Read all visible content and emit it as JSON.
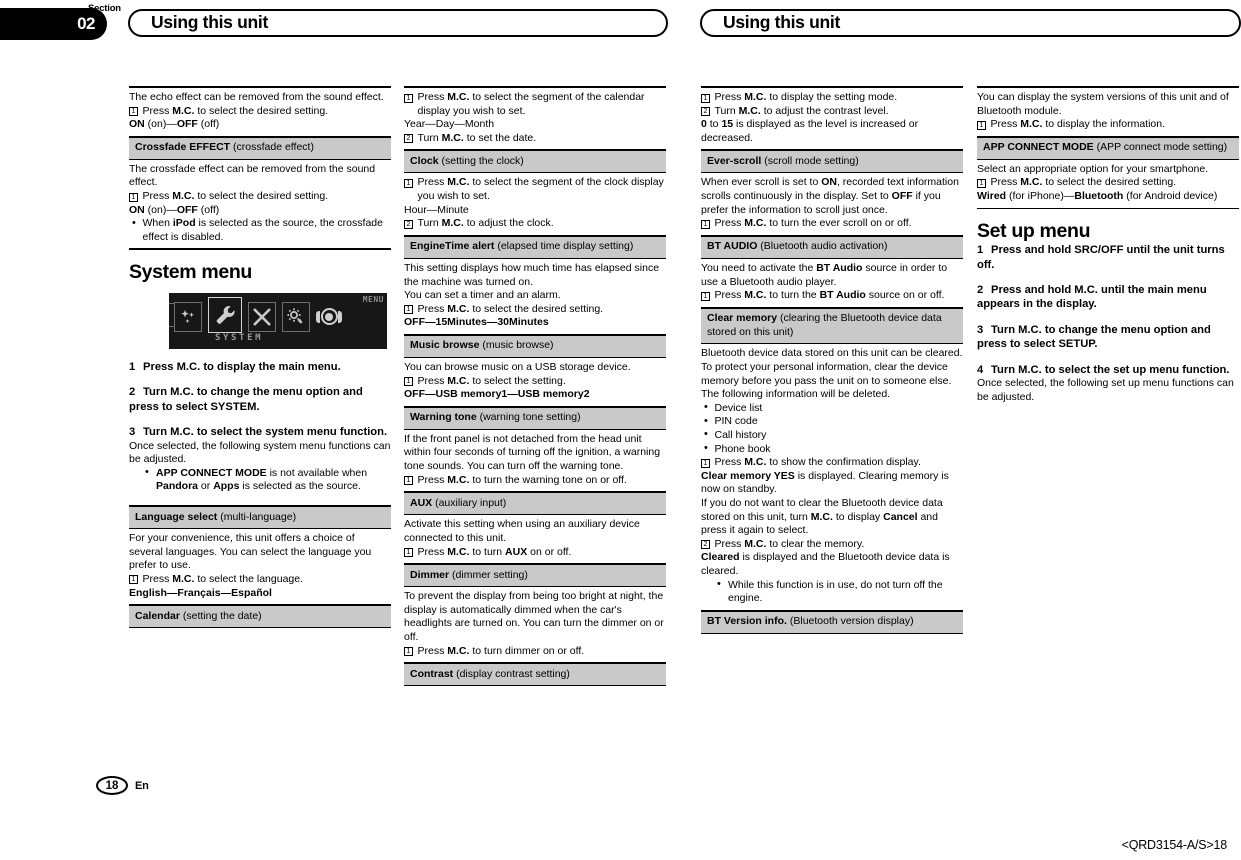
{
  "header": {
    "section_word": "Section",
    "section_number": "02",
    "title_left": "Using this unit",
    "title_right": "Using this unit"
  },
  "footer": {
    "page_number": "18",
    "language_code": "En",
    "doc_code": "<QRD3154-A/S>18"
  },
  "display_graphic": {
    "selected_label": "SYSTEM",
    "menu_label": "MENU"
  },
  "col1": {
    "echo_text": "The echo effect can be removed from the sound effect.",
    "echo_step1": "Press <b>M.C.</b> to select the desired setting.",
    "echo_options": "<b>ON</b> (on)—<b>OFF</b> (off)",
    "crossfade_head": "<b>Crossfade EFFECT</b> (crossfade effect)",
    "crossfade_text": "The crossfade effect can be removed from the sound effect.",
    "crossfade_step1": "Press <b>M.C.</b> to select the desired setting.",
    "crossfade_options": "<b>ON</b> (on)—<b>OFF</b> (off)",
    "crossfade_bullet": "When <b>iPod</b> is selected as the source, the crossfade effect is disabled.",
    "system_menu_heading": "System menu",
    "step1": "Press M.C. to display the main menu.",
    "step2": "Turn M.C. to change the menu option and press to select SYSTEM.",
    "step3": "Turn M.C. to select the system menu function.",
    "step3_text": "Once selected, the following system menu functions can be adjusted.",
    "step3_bullet": "<b>APP CONNECT MODE</b> is not available when <b>Pandora</b> or <b>Apps</b> is selected as the source.",
    "language_head": "<b>Language select</b> (multi-language)",
    "language_text": "For your convenience, this unit offers a choice of several languages. You can select the language you prefer to use.",
    "language_step1": "Press <b>M.C.</b> to select the language.",
    "language_options": "<b>English—Français—Español</b>",
    "calendar_head": "<b>Calendar</b> (setting the date)"
  },
  "col2": {
    "calendar_step1": "Press <b>M.C.</b> to select the segment of the calendar display you wish to set.",
    "calendar_options": "Year—Day—Month",
    "calendar_step2": "Turn <b>M.C.</b> to set the date.",
    "clock_head": "<b>Clock</b> (setting the clock)",
    "clock_step1": "Press <b>M.C.</b> to select the segment of the clock display you wish to set.",
    "clock_options": "Hour—Minute",
    "clock_step2": "Turn <b>M.C.</b> to adjust the clock.",
    "engine_head": "<b>EngineTime alert</b> (elapsed time display setting)",
    "engine_text1": "This setting displays how much time has elapsed since the machine was turned on.",
    "engine_text2": "You can set a timer and an alarm.",
    "engine_step1": "Press <b>M.C.</b> to select the desired setting.",
    "engine_options": "<b>OFF—15Minutes—30Minutes</b>",
    "music_head": "<b>Music browse</b> (music browse)",
    "music_text": "You can browse music on a USB storage device.",
    "music_step1": "Press <b>M.C.</b> to select the setting.",
    "music_options": "<b>OFF—USB memory1—USB memory2</b>",
    "warning_head": "<b>Warning tone</b> (warning tone setting)",
    "warning_text": "If the front panel is not detached from the head unit within four seconds of turning off the ignition, a warning tone sounds. You can turn off the warning tone.",
    "warning_step1": "Press <b>M.C.</b> to turn the warning tone on or off.",
    "aux_head": "<b>AUX</b> (auxiliary input)",
    "aux_text": "Activate this setting when using an auxiliary device connected to this unit.",
    "aux_step1": "Press <b>M.C.</b> to turn <b>AUX</b> on or off.",
    "dimmer_head": "<b>Dimmer</b> (dimmer setting)",
    "dimmer_text": "To prevent the display from being too bright at night, the display is automatically dimmed when the car's headlights are turned on. You can turn the dimmer on or off.",
    "dimmer_step1": "Press <b>M.C.</b> to turn dimmer on or off.",
    "contrast_head": "<b>Contrast</b> (display contrast setting)"
  },
  "col3": {
    "contrast_step1": "Press <b>M.C.</b> to display the setting mode.",
    "contrast_step2": "Turn <b>M.C.</b> to adjust the contrast level.",
    "contrast_level": "<b>0</b> to <b>15</b> is displayed as the level is increased or decreased.",
    "everscroll_head": "<b>Ever-scroll</b> (scroll mode setting)",
    "everscroll_text": "When ever scroll is set to <b>ON</b>, recorded text information scrolls continuously in the display. Set to <b>OFF</b> if you prefer the information to scroll just once.",
    "everscroll_step1": "Press <b>M.C.</b> to turn the ever scroll on or off.",
    "btaudio_head": "<b>BT AUDIO</b> (Bluetooth audio activation)",
    "btaudio_text": "You need to activate the <b>BT Audio</b> source in order to use a Bluetooth audio player.",
    "btaudio_step1": "Press <b>M.C.</b> to turn the <b>BT Audio</b> source on or off.",
    "clearmem_head": "<b>Clear memory</b> (clearing the Bluetooth device data stored on this unit)",
    "clearmem_text": "Bluetooth device data stored on this unit can be cleared. To protect your personal information, clear the device memory before you pass the unit on to someone else. The following information will be deleted.",
    "clearmem_items": [
      "Device list",
      "PIN code",
      "Call history",
      "Phone book"
    ],
    "clearmem_step1": "Press <b>M.C.</b> to show the confirmation display.",
    "clearmem_step1_a": "<b>Clear memory YES</b> is displayed. Clearing memory is now on standby.",
    "clearmem_step1_b": "If you do not want to clear the Bluetooth device data stored on this unit, turn <b>M.C.</b> to display <b>Cancel</b> and press it again to select.",
    "clearmem_step2": "Press <b>M.C.</b> to clear the memory.",
    "clearmem_step2_a": "<b>Cleared</b> is displayed and the Bluetooth device data is cleared.",
    "clearmem_step2_bullet": "While this function is in use, do not turn off the engine.",
    "btversion_head": "<b>BT Version info.</b> (Bluetooth version display)"
  },
  "col4": {
    "btversion_text": "You can display the system versions of this unit and of Bluetooth module.",
    "btversion_step1": "Press <b>M.C.</b> to display the information.",
    "appconnect_head": "<b>APP CONNECT MODE</b> (APP connect mode setting)",
    "appconnect_text": "Select an appropriate option for your smartphone.",
    "appconnect_step1": "Press <b>M.C.</b> to select the desired setting.",
    "appconnect_options": "<b>Wired</b> (for iPhone)—<b>Bluetooth</b> (for Android device)",
    "setup_menu_heading": "Set up menu",
    "step1": "Press and hold SRC/OFF until the unit turns off.",
    "step2": "Press and hold M.C. until the main menu appears in the display.",
    "step3": "Turn M.C. to change the menu option and press to select SETUP.",
    "step4": "Turn M.C. to select the set up menu function.",
    "step4_text": "Once selected, the following set up menu functions can be adjusted."
  }
}
